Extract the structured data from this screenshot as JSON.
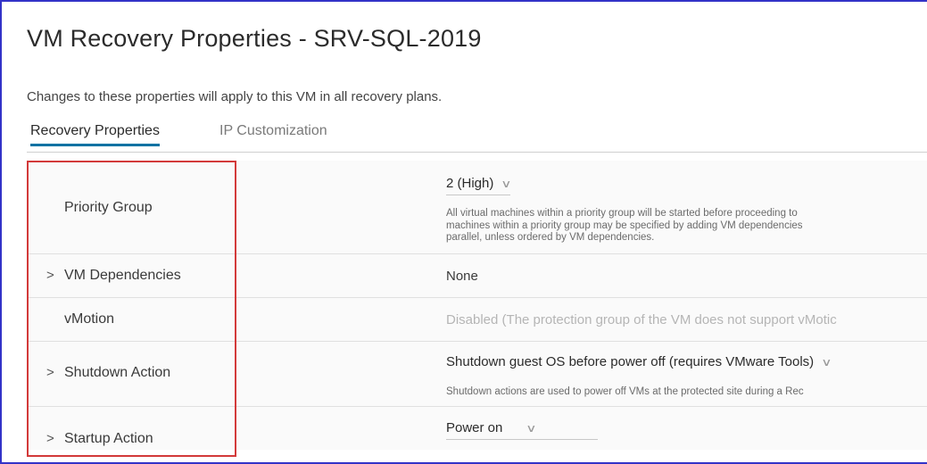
{
  "page": {
    "title": "VM Recovery Properties - SRV-SQL-2019",
    "subtitle": "Changes to these properties will apply to this VM in all recovery plans."
  },
  "tabs": [
    {
      "label": "Recovery Properties",
      "active": true
    },
    {
      "label": "IP Customization",
      "active": false
    }
  ],
  "properties": {
    "priority_group": {
      "label": "Priority Group",
      "value": "2 (High)",
      "help_lines": [
        "All virtual machines within a priority group will be started before proceeding to",
        "machines within a priority group may be specified by adding VM dependencies",
        "parallel, unless ordered by VM dependencies."
      ]
    },
    "vm_dependencies": {
      "label": "VM Dependencies",
      "value": "None"
    },
    "vmotion": {
      "label": "vMotion",
      "value": "Disabled (The protection group of the VM does not support vMotic"
    },
    "shutdown_action": {
      "label": "Shutdown Action",
      "value": "Shutdown guest OS before power off (requires VMware Tools)",
      "help": "Shutdown actions are used to power off VMs at the protected site during a Rec"
    },
    "startup_action": {
      "label": "Startup Action",
      "value": "Power on"
    }
  },
  "icons": {
    "caret": "chevron-right-icon",
    "dropdown": "chevron-down-icon"
  },
  "colors": {
    "tab_accent": "#0072a3",
    "highlight_box": "#d33a3a",
    "window_border": "#3333c8"
  }
}
